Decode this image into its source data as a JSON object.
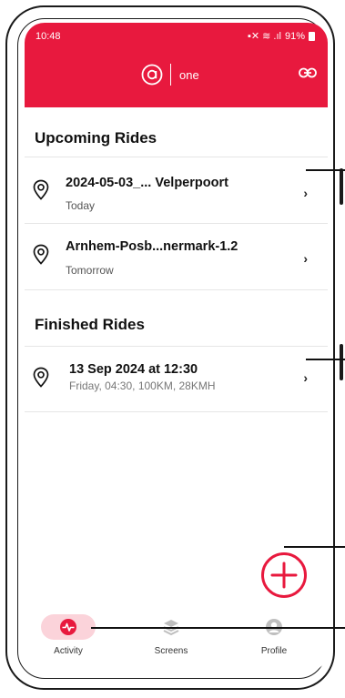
{
  "status_bar": {
    "time": "10:48",
    "battery": "91%"
  },
  "header": {
    "logo_letter": "a",
    "logo_text": "one",
    "link_icon": "link-icon"
  },
  "upcoming": {
    "title": "Upcoming Rides",
    "rides": [
      {
        "name": "2024-05-03_... Velperpoort",
        "when": "Today"
      },
      {
        "name": "Arnhem-Posb...nermark-1.2",
        "when": "Tomorrow"
      }
    ]
  },
  "finished": {
    "title": "Finished Rides",
    "rides": [
      {
        "name": "13 Sep 2024 at 12:30",
        "details": "Friday, 04:30, 100KM, 28KMH"
      }
    ]
  },
  "fab": {
    "icon": "plus-icon",
    "color": "#e8193e"
  },
  "tabs": [
    {
      "label": "Activity",
      "icon": "activity-icon",
      "active": true
    },
    {
      "label": "Screens",
      "icon": "layers-icon",
      "active": false
    },
    {
      "label": "Profile",
      "icon": "user-icon",
      "active": false
    }
  ],
  "colors": {
    "brand": "#e8193e",
    "active_tab_bg": "#fbd3da",
    "inactive_icon": "#bfbfbf"
  }
}
